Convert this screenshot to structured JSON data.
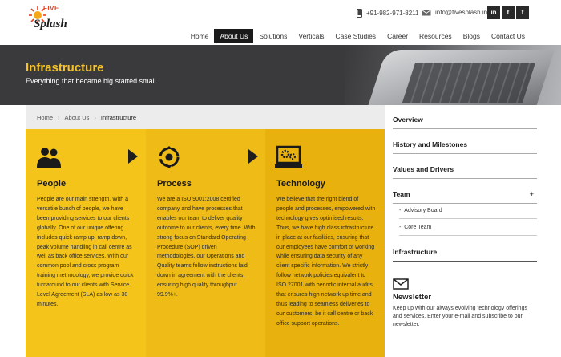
{
  "brand": {
    "top": "FIVE",
    "name": "Splash"
  },
  "contact": {
    "phone": "+91-982-971-8211",
    "email": "info@fivesplash.in"
  },
  "social": [
    "in",
    "t",
    "f"
  ],
  "nav": [
    {
      "label": "Home"
    },
    {
      "label": "About Us",
      "active": true
    },
    {
      "label": "Solutions"
    },
    {
      "label": "Verticals"
    },
    {
      "label": "Case Studies"
    },
    {
      "label": "Career"
    },
    {
      "label": "Resources"
    },
    {
      "label": "Blogs"
    },
    {
      "label": "Contact Us"
    }
  ],
  "banner": {
    "title": "Infrastructure",
    "subtitle": "Everything that became big started small."
  },
  "breadcrumb": {
    "home": "Home",
    "parent": "About Us",
    "current": "Infrastructure"
  },
  "columns": [
    {
      "title": "People",
      "icon": "people-icon",
      "text": "People are our main strength. With a versatile bunch of people, we have been providing services to our clients globally. One of our unique offering includes quick ramp up, ramp down, peak volume handling in call centre as well as back office services. With our common pool and cross program training methodology, we provide quick turnaround to our clients with Service Level Agreement (SLA) as low as 30 minutes."
    },
    {
      "title": "Process",
      "icon": "process-cycle-icon",
      "text": "We are a ISO 9001:2008 certified company and have processes that enables our team to deliver quality outcome to our clients, every time. With strong focus on Standard Operating Procedure (SOP) driven methodologies, our Operations and Quality teams follow instructions laid down in agreement with the clients, ensuring high quality throughput 99.9%+."
    },
    {
      "title": "Technology",
      "icon": "laptop-gears-icon",
      "text": "We believe that the right blend of people and processes, empowered with technology gives optimised results. Thus, we have high class infrastructure in place at our facilities, ensuring that our employees have comfort of working while ensuring data security of any client specific information. We strictly follow network policies equivalent to ISO 27001 with periodic internal audits that ensures high network up time and thus leading to seamless deliveries to our customers, be it call centre or back office support operations."
    }
  ],
  "sidebar": {
    "items": [
      "Overview",
      "History and Milestones",
      "Values and Drivers",
      "Team"
    ],
    "team_toggle": "+",
    "sub_items": [
      "Advisory Board",
      "Core Team"
    ],
    "current": "Infrastructure"
  },
  "newsletter": {
    "title": "Newsletter",
    "text": "Keep up with our always evolving technology offerings and services. Enter your e-mail and subscribe to our newsletter."
  },
  "colors": {
    "accent": "#f5c41a",
    "dark": "#1a1a1a",
    "banner_title": "#f5c22a"
  }
}
